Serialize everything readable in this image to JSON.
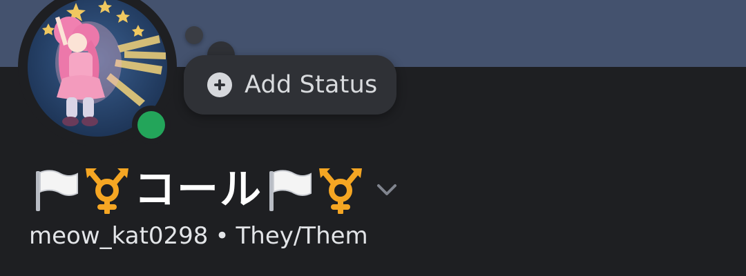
{
  "colors": {
    "banner": "#44526e",
    "background": "#1e1f22",
    "status_online": "#23a55a",
    "bubble": "#2f3136",
    "emoji_orange": "#f5a623"
  },
  "avatar": {
    "icon": "avatar"
  },
  "presence": {
    "status": "online",
    "icon": "online-status-icon"
  },
  "status_bubble": {
    "label": "Add Status",
    "icon": "plus-circle-icon"
  },
  "profile": {
    "display_name": "コール",
    "name_emojis": [
      "white-flag-icon",
      "transgender-symbol-icon",
      "white-flag-icon",
      "transgender-symbol-icon"
    ],
    "dropdown_icon": "chevron-down-icon",
    "username": "meow_kat0298",
    "separator": "•",
    "pronouns": "They/Them"
  }
}
